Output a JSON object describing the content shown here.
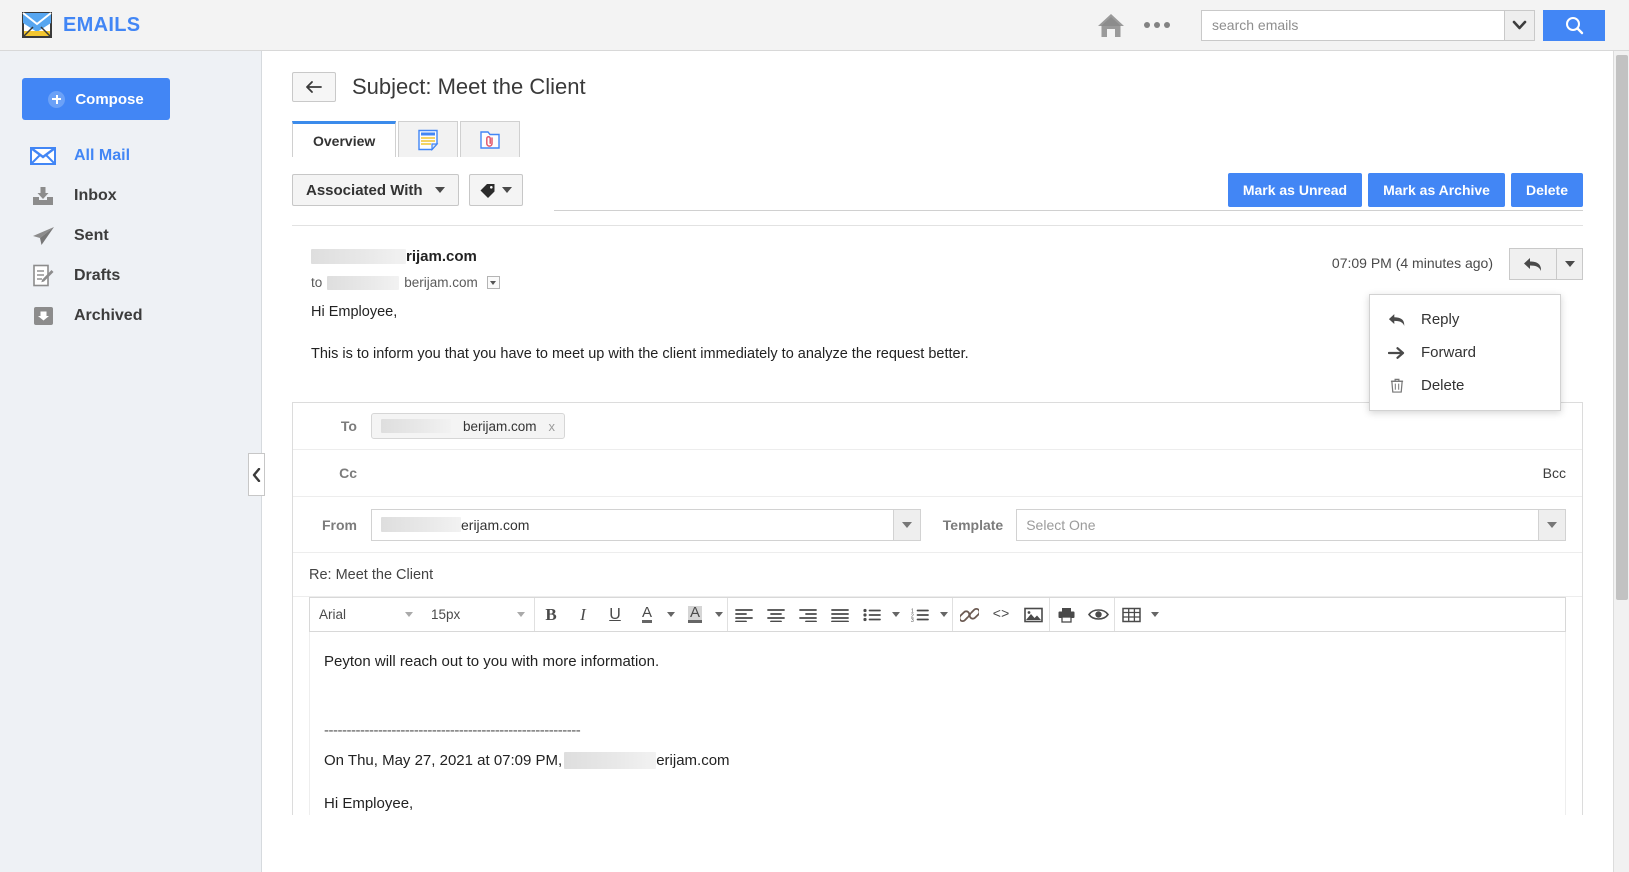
{
  "app": {
    "brand_title": "EMAILS",
    "brand_icon": "envelope-icon"
  },
  "header": {
    "home_icon": "home-icon",
    "more_icon": "more-dots-icon",
    "search_placeholder": "search emails",
    "search_value": "",
    "search_dropdown_icon": "chevron-down-icon",
    "search_button_icon": "search-icon"
  },
  "sidebar": {
    "compose_label": "Compose",
    "compose_icon": "plus-circle-icon",
    "collapse_icon": "chevron-left-icon",
    "items": [
      {
        "label": "All Mail",
        "icon": "envelope-icon",
        "active": true
      },
      {
        "label": "Inbox",
        "icon": "inbox-download-icon",
        "active": false
      },
      {
        "label": "Sent",
        "icon": "paper-plane-icon",
        "active": false
      },
      {
        "label": "Drafts",
        "icon": "draft-pencil-icon",
        "active": false
      },
      {
        "label": "Archived",
        "icon": "archive-box-icon",
        "active": false
      }
    ]
  },
  "main": {
    "back_icon": "back-arrow-icon",
    "subject_title": "Subject: Meet the Client",
    "tabs": [
      {
        "label": "Overview",
        "icon": "",
        "active": true
      },
      {
        "label": "",
        "icon": "notes-icon",
        "active": false
      },
      {
        "label": "",
        "icon": "attachment-folder-icon",
        "active": false
      }
    ],
    "toolbar": {
      "associated_with_label": "Associated With",
      "associated_with_caret": "chevron-down-icon",
      "tag_icon": "tag-icon",
      "tag_caret": "chevron-down-icon",
      "mark_unread_label": "Mark as Unread",
      "mark_archive_label": "Mark as Archive",
      "delete_label": "Delete"
    }
  },
  "message": {
    "sender_domain": "rijam.com",
    "sender_redacted": true,
    "to_prefix": "to",
    "to_domain": "berijam.com",
    "to_caret_icon": "chevron-down-icon",
    "timestamp": "07:09 PM (4 minutes ago)",
    "reply_icon": "reply-arrow-icon",
    "reply_caret_icon": "chevron-down-icon",
    "greeting": "Hi Employee,",
    "body": "This is to inform you that you have to meet up with the client immediately to analyze the request better."
  },
  "dropdown": {
    "items": [
      {
        "label": "Reply",
        "icon": "reply-arrow-icon"
      },
      {
        "label": "Forward",
        "icon": "forward-arrow-icon"
      },
      {
        "label": "Delete",
        "icon": "trash-icon"
      }
    ]
  },
  "compose": {
    "to_label": "To",
    "to_chip_domain": "berijam.com",
    "to_chip_remove": "x",
    "cc_label": "Cc",
    "bcc_label": "Bcc",
    "from_label": "From",
    "from_value_domain": "erijam.com",
    "from_caret": "chevron-down-icon",
    "template_label": "Template",
    "template_placeholder": "Select One",
    "template_caret": "chevron-down-icon",
    "subject_value": "Re: Meet the Client",
    "editor": {
      "font_family": "Arial",
      "font_size": "15px",
      "buttons": [
        {
          "name": "bold-icon",
          "glyph": "B"
        },
        {
          "name": "italic-icon",
          "glyph": "I"
        },
        {
          "name": "underline-icon",
          "glyph": "U"
        },
        {
          "name": "font-color-icon",
          "glyph": "A"
        },
        {
          "name": "highlight-color-icon",
          "glyph": "A"
        },
        {
          "name": "align-left-icon",
          "glyph": ""
        },
        {
          "name": "align-center-icon",
          "glyph": ""
        },
        {
          "name": "align-right-icon",
          "glyph": ""
        },
        {
          "name": "align-justify-icon",
          "glyph": ""
        },
        {
          "name": "bullet-list-icon",
          "glyph": ""
        },
        {
          "name": "numbered-list-icon",
          "glyph": ""
        },
        {
          "name": "link-icon",
          "glyph": ""
        },
        {
          "name": "code-icon",
          "glyph": "<>"
        },
        {
          "name": "image-icon",
          "glyph": ""
        },
        {
          "name": "print-icon",
          "glyph": ""
        },
        {
          "name": "preview-eye-icon",
          "glyph": ""
        },
        {
          "name": "table-icon",
          "glyph": ""
        }
      ],
      "content": {
        "line1": "Peyton will reach out to you with more information.",
        "separator": "---------------------------------------------------------",
        "quote_header_prefix": "On Thu, May 27, 2021 at 07:09 PM,",
        "quote_header_domain": "erijam.com",
        "quote_greeting": "Hi Employee,"
      }
    }
  },
  "colors": {
    "accent_blue": "#4286f5",
    "tab_active_blue": "#3b8beb",
    "sidebar_bg": "#eef1f5",
    "topbar_bg": "#f3f3f3"
  }
}
